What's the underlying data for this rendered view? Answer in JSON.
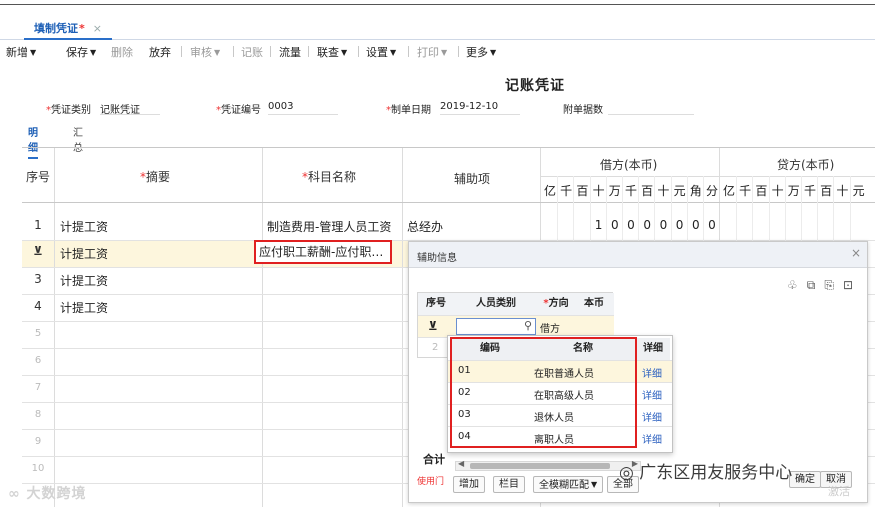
{
  "tab": {
    "label": "填制凭证",
    "star": "*",
    "close": "×"
  },
  "toolbar": {
    "add": "新增",
    "save": "保存",
    "delete": "删除",
    "discard": "放弃",
    "review": "审核",
    "post": "记账",
    "flow": "流量",
    "linked": "联查",
    "settings": "设置",
    "print": "打印",
    "more": "更多"
  },
  "title": "记账凭证",
  "header": {
    "type_label": "凭证类别",
    "type_value": "记账凭证",
    "number_label": "凭证编号",
    "number_value": "0003",
    "date_label": "制单日期",
    "date_value": "2019-12-10",
    "attach_label": "附单据数"
  },
  "subtabs": {
    "detail": "明细",
    "summary": "汇总"
  },
  "grid": {
    "columns": {
      "seq": "序号",
      "summary": "摘要",
      "account": "科目名称",
      "aux": "辅助项",
      "debit": "借方(本币)",
      "credit": "贷方(本币)"
    },
    "debit_digits": [
      "亿",
      "千",
      "百",
      "十",
      "万",
      "千",
      "百",
      "十",
      "元",
      "角",
      "分"
    ],
    "credit_digits": [
      "亿",
      "千",
      "百",
      "十",
      "万",
      "千",
      "百",
      "十",
      "元"
    ],
    "rows": [
      {
        "seq": "1",
        "summary": "计提工资",
        "account": "制造费用-管理人员工资",
        "aux": "总经办",
        "debit_amount": [
          "1",
          "0",
          "0",
          "0",
          "0",
          "0",
          "0",
          "0"
        ]
      },
      {
        "seq": "",
        "summary": "计提工资",
        "account": "应付职工薪酬-应付职…",
        "aux": ""
      },
      {
        "seq": "3",
        "summary": "计提工资"
      },
      {
        "seq": "4",
        "summary": "计提工资"
      },
      {
        "seq": "5"
      },
      {
        "seq": "6"
      },
      {
        "seq": "7"
      },
      {
        "seq": "8"
      },
      {
        "seq": "9"
      },
      {
        "seq": "10"
      }
    ]
  },
  "popup": {
    "title": "辅助信息",
    "close": "×",
    "table": {
      "seq": "序号",
      "type": "人员类别",
      "direction": "方向",
      "amount": "本币",
      "dir_value": "借方",
      "row2": "2"
    },
    "dropdown": {
      "headers": {
        "code": "编码",
        "name": "名称",
        "detail": "详细"
      },
      "items": [
        {
          "code": "01",
          "name": "在职普通人员",
          "detail": "详细"
        },
        {
          "code": "02",
          "name": "在职高级人员",
          "detail": "详细"
        },
        {
          "code": "03",
          "name": "退休人员",
          "detail": "详细"
        },
        {
          "code": "04",
          "name": "离职人员",
          "detail": "详细"
        }
      ]
    },
    "sum_label": "合计",
    "usage_label": "使用门",
    "buttons": {
      "add": "增加",
      "column": "栏目",
      "match": "全模糊匹配",
      "all": "全部"
    }
  },
  "footer_buttons": {
    "ok": "确定",
    "cancel": "取消"
  },
  "watermarks": {
    "left": "大数跨境",
    "right": "广东区用友服务中心",
    "fade": "激活"
  }
}
